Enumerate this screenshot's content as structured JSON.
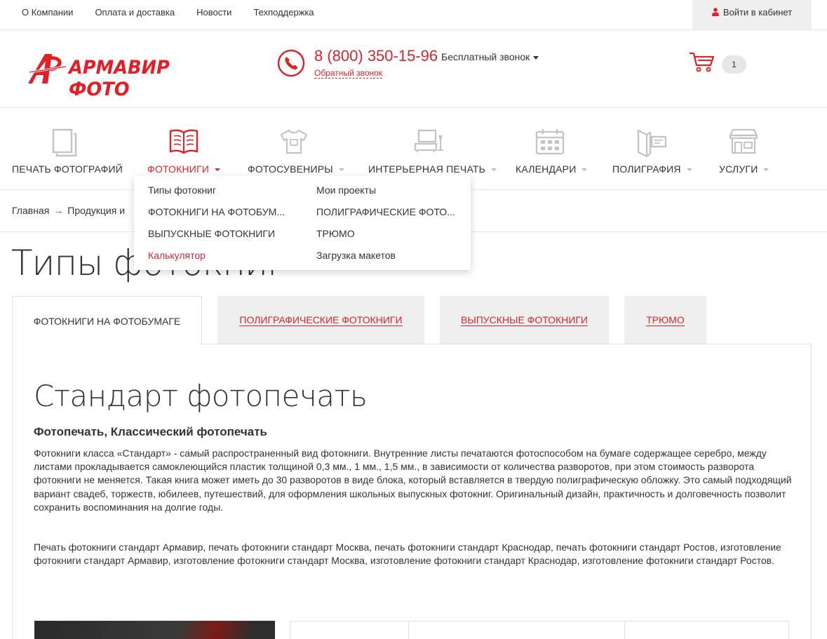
{
  "topnav": {
    "items": [
      "О Компании",
      "Оплата и доставка",
      "Новости",
      "Техподдержка"
    ],
    "login_label": "Войти в кабинет"
  },
  "header": {
    "logo_text": "АРМАВИР ФОТО",
    "phone_number": "8 (800) 350-15-96",
    "phone_label": "Бесплатный звонок",
    "callback_label": "Обратный звонок",
    "cart_count": "1"
  },
  "menu": {
    "items": [
      {
        "label": "ПЕЧАТЬ ФОТОГРАФИЙ",
        "icon": "photo-stack-icon",
        "has_dropdown": false
      },
      {
        "label": "ФОТОКНИГИ",
        "icon": "book-icon",
        "has_dropdown": true,
        "active": true
      },
      {
        "label": "ФОТОСУВЕНИРЫ",
        "icon": "tshirt-icon",
        "has_dropdown": true
      },
      {
        "label": "ИНТЕРЬЕРНАЯ ПЕЧАТЬ",
        "icon": "interior-icon",
        "has_dropdown": true
      },
      {
        "label": "КАЛЕНДАРИ",
        "icon": "calendar-icon",
        "has_dropdown": true
      },
      {
        "label": "ПОЛИГРАФИЯ",
        "icon": "brochure-icon",
        "has_dropdown": true
      },
      {
        "label": "УСЛУГИ",
        "icon": "store-icon",
        "has_dropdown": true
      }
    ]
  },
  "dropdown": {
    "left": [
      "Типы фотокниг",
      "ФОТОКНИГИ НА ФОТОБУМ...",
      "ВЫПУСКНЫЕ ФОТОКНИГИ",
      "Калькулятор"
    ],
    "right": [
      "Мои проекты",
      "ПОЛИГРАФИЧЕСКИЕ ФОТО...",
      "ТРЮМО",
      "Загрузка макетов"
    ]
  },
  "breadcrumb": {
    "home": "Главная",
    "arrow": "→",
    "current": "Продукция и"
  },
  "page_title": "Типы фотокниг",
  "tabs": [
    {
      "label": "ФОТОКНИГИ НА ФОТОБУМАГЕ",
      "active": true
    },
    {
      "label": "ПОЛИГРАФИЧЕСКИЕ ФОТОКНИГИ",
      "active": false
    },
    {
      "label": "ВЫПУСКНЫЕ ФОТОКНИГИ",
      "active": false
    },
    {
      "label": "ТРЮМО",
      "active": false
    }
  ],
  "content": {
    "title": "Стандарт фотопечать",
    "subtitle": "Фотопечать, Классический фотопечать",
    "paragraph1": "Фотокниги класса «Стандарт» - самый распространенный вид фотокниги. Внутренние листы печатаются фотоспособом на бумаге содержащее серебро, между листами прокладывается самоклеющийся пластик толщиной 0,3 мм., 1 мм., 1,5 мм., в зависимости от количества разворотов, при этом стоимость разворота фотокниги не меняется. Такая книга может иметь до 30 разворотов в виде блока, который вставляется в твердую полиграфическую обложку. Это самый подходящий вариант свадеб, торжеств, юбилеев, путешествий, для оформления школьных выпускных фотокниг. Оригинальный дизайн, практичность и долговечность позволит сохранить воспоминания на долгие годы.",
    "paragraph2": "Печать фотокниги стандарт Армавир, печать фотокниги стандарт Москва, печать фотокниги стандарт Краснодар, печать фотокниги стандарт Ростов, изготовление фотокниги  стандарт Армавир, изготовление фотокниги  стандарт Москва, изготовление фотокниги  стандарт Краснодар, изготовление фотокниги  стандарт Ростов."
  },
  "colors": {
    "accent": "#d9262b",
    "icon_gray": "#c4c4c4",
    "border": "#e6e6e6",
    "tab_bg": "#efefef"
  }
}
